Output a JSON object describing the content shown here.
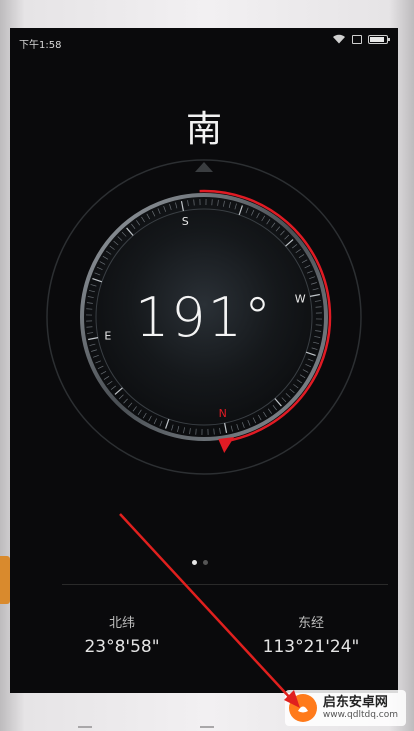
{
  "status": {
    "time": "下午1:58"
  },
  "compass": {
    "direction_label": "南",
    "heading_value": "191°",
    "cardinals": {
      "n": "N",
      "s": "S",
      "e": "E",
      "w": "W"
    },
    "accent_color": "#e01b24"
  },
  "pager": {
    "active_index": 0,
    "count": 2
  },
  "location": {
    "latitude_label": "北纬",
    "latitude_value": "23°8'58\"",
    "longitude_label": "东经",
    "longitude_value": "113°21'24\""
  },
  "watermark": {
    "title": "启东安卓网",
    "url": "www.qdltdq.com"
  },
  "icons": [
    "wifi-icon",
    "sim-icon",
    "battery-icon",
    "watermark-logo-icon"
  ]
}
